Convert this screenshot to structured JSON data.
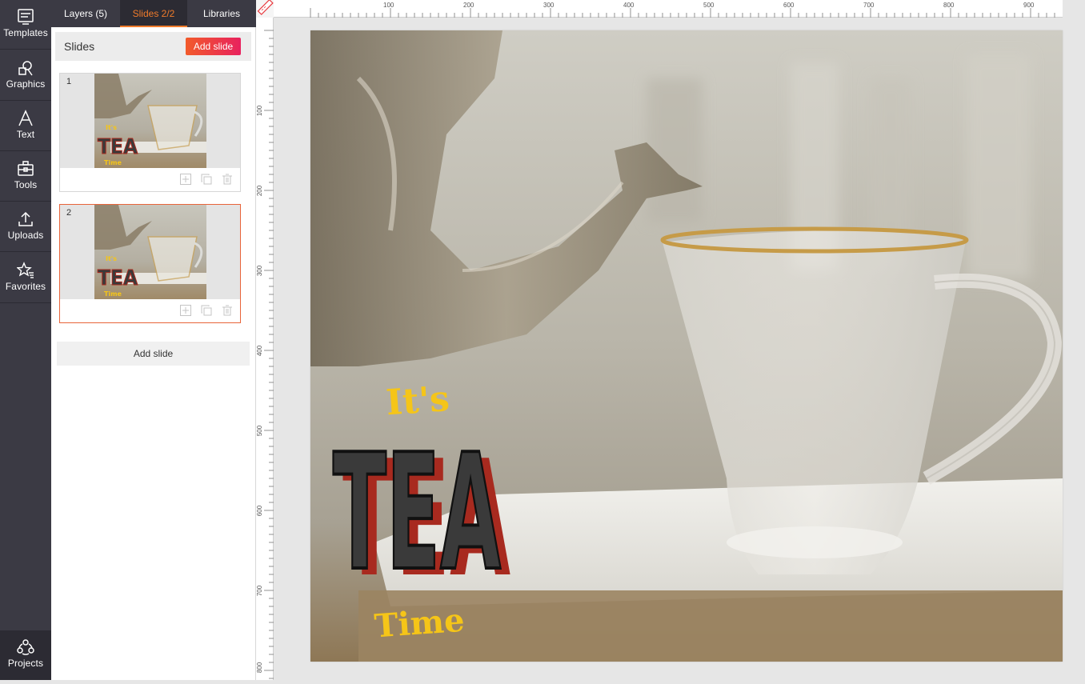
{
  "rail": {
    "items": [
      {
        "label": "Templates",
        "icon": "templates-icon"
      },
      {
        "label": "Graphics",
        "icon": "graphics-icon"
      },
      {
        "label": "Text",
        "icon": "text-icon"
      },
      {
        "label": "Tools",
        "icon": "tools-icon"
      },
      {
        "label": "Uploads",
        "icon": "uploads-icon"
      },
      {
        "label": "Favorites",
        "icon": "favorites-icon"
      }
    ],
    "projects": {
      "label": "Projects",
      "icon": "projects-icon"
    }
  },
  "panel": {
    "tabs": [
      {
        "label": "Layers (5)"
      },
      {
        "label": "Slides 2/2"
      },
      {
        "label": "Libraries"
      }
    ],
    "slides_title": "Slides",
    "add_slide_top": "Add slide",
    "add_slide_bottom": "Add slide",
    "slides": [
      {
        "number": "1"
      },
      {
        "number": "2"
      }
    ]
  },
  "ruler": {
    "top_ticks": [
      "100",
      "200",
      "300",
      "400",
      "500",
      "600",
      "700",
      "800",
      "900"
    ],
    "left_ticks": [
      "100",
      "200",
      "300",
      "400",
      "500",
      "600",
      "700",
      "800"
    ]
  },
  "canvas": {
    "text_its": "It's",
    "text_tea": "TEA",
    "text_time": "Time",
    "colors": {
      "yellow": "#f5c518",
      "red": "#a82a1f",
      "dark": "#3a3a3a"
    }
  },
  "colors": {
    "rail_bg": "#3b3a44",
    "accent": "#f07b2b",
    "button_gradient_start": "#f25a2a",
    "button_gradient_end": "#e8225e"
  }
}
